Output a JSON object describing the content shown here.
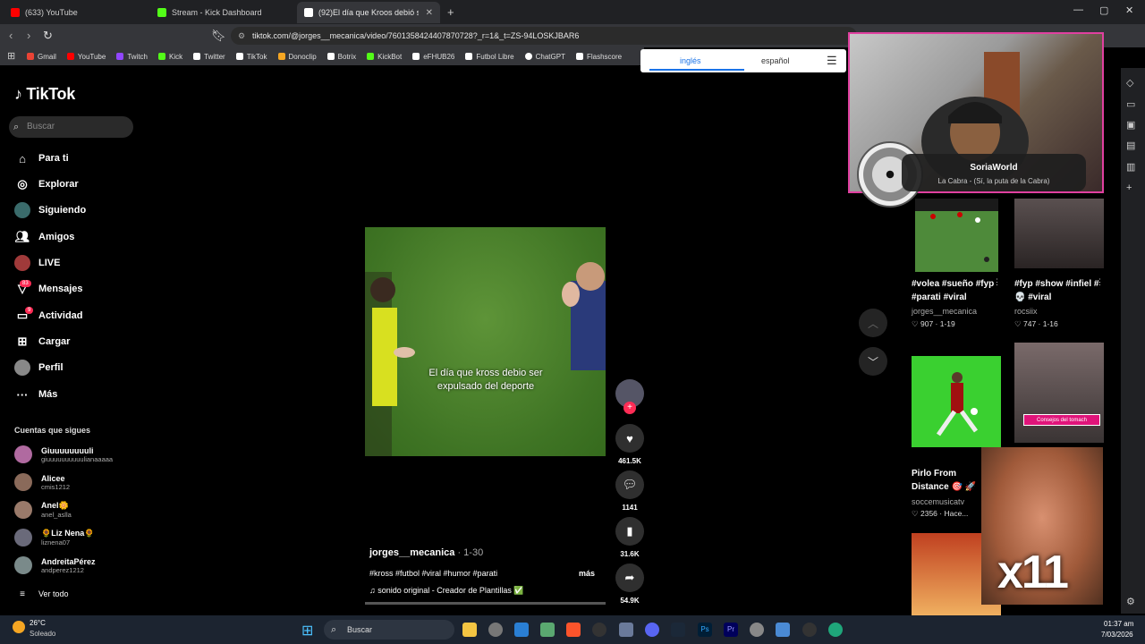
{
  "browser": {
    "tabs": [
      {
        "label": "(633) YouTube",
        "color": "#ff0000"
      },
      {
        "label": "Stream - Kick Dashboard",
        "color": "#53fc18"
      },
      {
        "label": "(92)El día que Kroos debió ser",
        "color": "#ffffff"
      }
    ],
    "url": "tiktok.com/@jorges__mecanica/video/7601358424407870728?_r=1&_t=ZS-94LOSKJBAR6",
    "bookmarks": [
      {
        "label": "Gmail",
        "color": "#ea4335"
      },
      {
        "label": "YouTube",
        "color": "#ff0000"
      },
      {
        "label": "Twitch",
        "color": "#9146ff"
      },
      {
        "label": "Kick",
        "color": "#53fc18"
      },
      {
        "label": "Twitter",
        "color": "#ffffff"
      },
      {
        "label": "TikTok",
        "color": "#ffffff"
      },
      {
        "label": "Donoclip",
        "color": "#f5a623"
      },
      {
        "label": "Botrix",
        "color": "#ffffff"
      },
      {
        "label": "KickBot",
        "color": "#53fc18"
      },
      {
        "label": "eFHUB26",
        "color": "#ffffff"
      },
      {
        "label": "Futbol Libre",
        "color": "#ffffff"
      },
      {
        "label": "ChatGPT",
        "color": "#ffffff"
      },
      {
        "label": "Flashscore",
        "color": "#ffffff"
      }
    ],
    "translate": {
      "lang1": "inglés",
      "lang2": "español"
    }
  },
  "tiktok": {
    "logo": "TikTok",
    "search_placeholder": "Buscar",
    "nav": [
      {
        "label": "Para ti",
        "icon": "home-icon"
      },
      {
        "label": "Explorar",
        "icon": "compass-icon"
      },
      {
        "label": "Siguiendo",
        "icon": "following-icon"
      },
      {
        "label": "Amigos",
        "icon": "friends-icon"
      },
      {
        "label": "LIVE",
        "icon": "live-icon"
      },
      {
        "label": "Mensajes",
        "icon": "messages-icon",
        "badge": "83"
      },
      {
        "label": "Actividad",
        "icon": "activity-icon",
        "badge": "9"
      },
      {
        "label": "Cargar",
        "icon": "upload-icon"
      },
      {
        "label": "Perfil",
        "icon": "profile-icon"
      },
      {
        "label": "Más",
        "icon": "more-icon"
      }
    ],
    "following_title": "Cuentas que sigues",
    "following": [
      {
        "name": "Giuuuuuuuuli",
        "handle": "giuuuuuuuuuulianaaaaa"
      },
      {
        "name": "Alicee",
        "handle": "cmis1212"
      },
      {
        "name": "Anel🌼",
        "handle": "anel_aslla"
      },
      {
        "name": "🌻Liz Nena🌻",
        "handle": "liznena07"
      },
      {
        "name": "AndreitaPérez",
        "handle": "andperez1212"
      }
    ],
    "see_all": "Ver todo"
  },
  "video": {
    "caption": "El día que kross debio ser expulsado del deporte",
    "author": "jorges__mecanica",
    "date": " · 1-30",
    "tags": "#kross #futbol #viral #humor #parati",
    "more": "más",
    "sound": "sonido original - Creador de Plantillas ✅",
    "likes": "461.5K",
    "comments": "1141",
    "saves": "31.6K",
    "shares": "54.9K",
    "progress": 0.0
  },
  "recommended": [
    {
      "title": "#volea #sueño #fyp #parati #viral",
      "author": "jorges__mecanica",
      "likes": "907",
      "date": "1-19"
    },
    {
      "title": "#fyp #show #infiel #💀 #viral",
      "author": "rocsiix",
      "likes": "747",
      "date": "1-16"
    },
    {
      "title": "",
      "author": "",
      "likes": "",
      "date": "",
      "overlay": "Consejos del tomach"
    },
    {
      "title": "Pirlo From Distance 🎯 🚀",
      "author": "soccemusicatv",
      "likes": "2356",
      "date": "Hace..."
    }
  ],
  "overlay": {
    "streamer": "SoriaWorld",
    "song": "La Cabra - (Sí, la puta de la Cabra)",
    "meme_text": "x11"
  },
  "taskbar": {
    "weather_temp": "26°C",
    "weather_desc": "Soleado",
    "search": "Buscar",
    "time": "01:37 am",
    "date": "7/03/2026"
  }
}
